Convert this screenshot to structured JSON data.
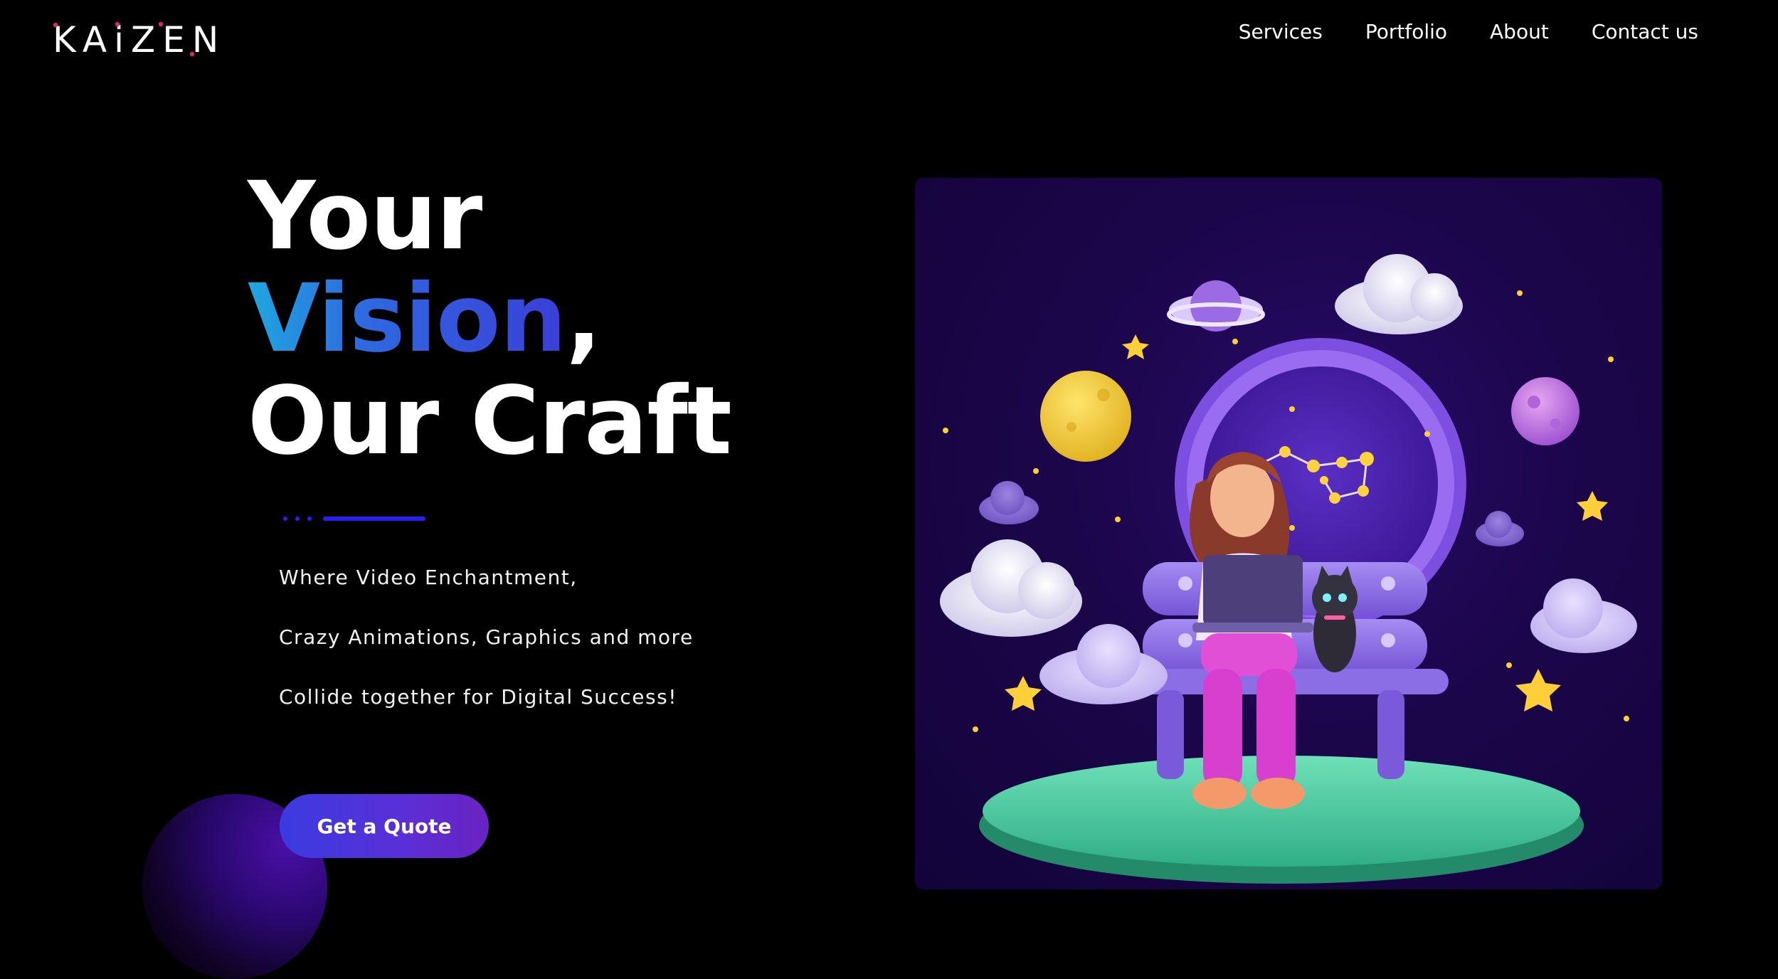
{
  "header": {
    "logo": "KAiZEN",
    "nav": [
      "Services",
      "Portfolio",
      "About",
      "Contact us"
    ]
  },
  "hero": {
    "line1": "Your",
    "line2_highlight": "Vision",
    "line2_suffix": ",",
    "line3": "Our Craft"
  },
  "tagline": [
    "Where Video Enchantment,",
    "Crazy Animations, Graphics and more",
    "Collide together for Digital Success!"
  ],
  "cta": {
    "label": "Get a Quote"
  },
  "colors": {
    "background": "#000000",
    "accent_blue": "#2b1ff0",
    "vision_gradient_start": "#1fa8e0",
    "vision_gradient_end": "#3a3ed8",
    "button_gradient_start": "#3a3be0",
    "button_gradient_end": "#6a22c2",
    "logo_dots": "#e0245e"
  },
  "icons": {
    "illustration": "3d-girl-laptop-cat-bench-space-illustration"
  }
}
